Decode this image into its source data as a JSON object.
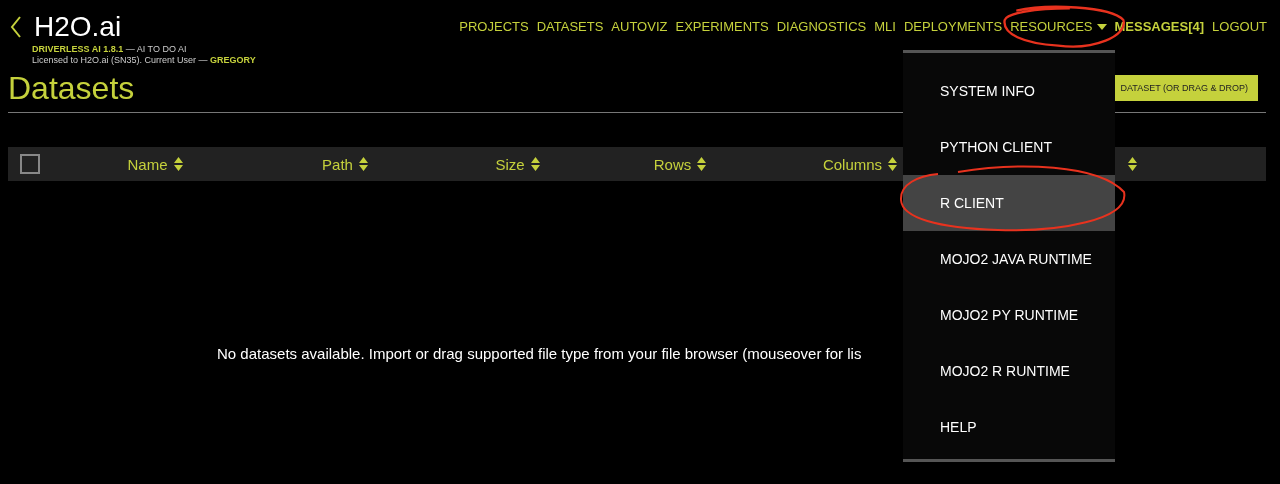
{
  "brand": {
    "logo": "H2O.ai",
    "product": "DRIVERLESS AI 1.8.1",
    "tagline": " — AI TO DO AI",
    "license": "Licensed to H2O.ai (SN35). Current User — ",
    "user": "GREGORY"
  },
  "nav": [
    {
      "label": "PROJECTS",
      "kind": "link"
    },
    {
      "label": "DATASETS",
      "kind": "link"
    },
    {
      "label": "AUTOVIZ",
      "kind": "link"
    },
    {
      "label": "EXPERIMENTS",
      "kind": "link"
    },
    {
      "label": "DIAGNOSTICS",
      "kind": "link"
    },
    {
      "label": "MLI",
      "kind": "link"
    },
    {
      "label": "DEPLOYMENTS",
      "kind": "link"
    },
    {
      "label": "RESOURCES",
      "kind": "dropdown"
    },
    {
      "label": "MESSAGES[4]",
      "kind": "bold"
    },
    {
      "label": "LOGOUT",
      "kind": "link"
    }
  ],
  "page_title": "Datasets",
  "add_button": "DATASET (OR DRAG & DROP)",
  "table": {
    "select_all": {
      "checked": false
    },
    "columns": [
      "Name",
      "Path",
      "Size",
      "Rows",
      "Columns"
    ],
    "empty_message": "No datasets available. Import or drag supported file type from your file browser (mouseover for lis"
  },
  "menu": {
    "items": [
      {
        "label": "SYSTEM INFO",
        "selected": false
      },
      {
        "label": "PYTHON CLIENT",
        "selected": false
      },
      {
        "label": "R CLIENT",
        "selected": true
      },
      {
        "label": "MOJO2 JAVA RUNTIME",
        "selected": false
      },
      {
        "label": "MOJO2 PY RUNTIME",
        "selected": false
      },
      {
        "label": "MOJO2 R RUNTIME",
        "selected": false
      },
      {
        "label": "HELP",
        "selected": false
      }
    ]
  }
}
